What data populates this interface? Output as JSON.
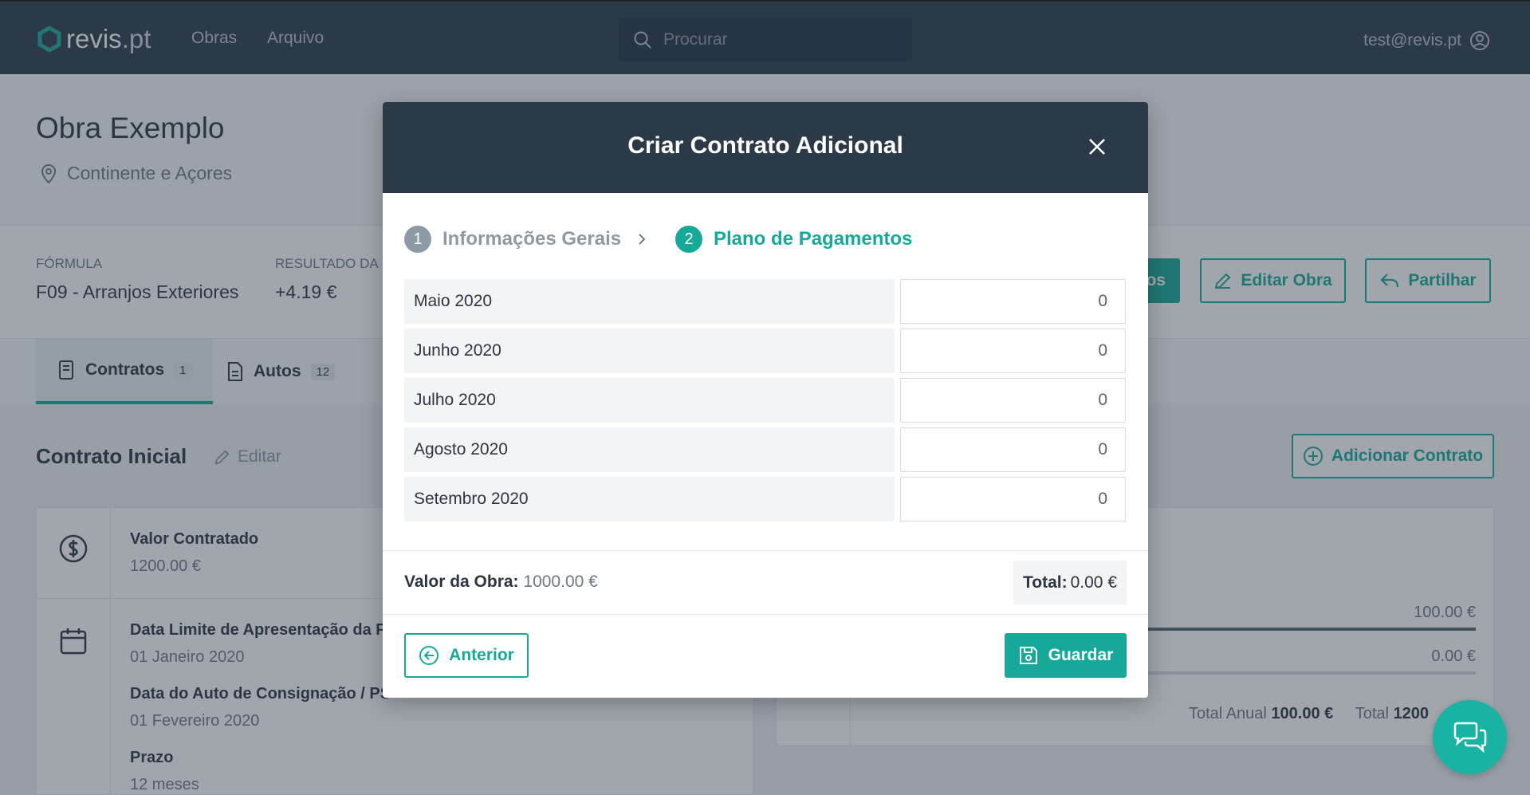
{
  "topbar": {
    "logo_text": "revis",
    "logo_suffix": ".pt",
    "nav": [
      "Obras",
      "Arquivo"
    ],
    "search_placeholder": "Procurar",
    "user_email": "test@revis.pt"
  },
  "obra": {
    "title": "Obra Exemplo",
    "location": "Continente e Açores"
  },
  "info": {
    "formula_label": "FÓRMULA",
    "formula_value": "F09 - Arranjos Exteriores",
    "resultado_label": "RESULTADO DA",
    "resultado_value": "+4.19 €",
    "partial_button_text": "ios",
    "edit_button": "Editar Obra",
    "share_button": "Partilhar"
  },
  "tabs": [
    {
      "label": "Contratos",
      "count": "1"
    },
    {
      "label": "Autos",
      "count": "12"
    }
  ],
  "contrato": {
    "title": "Contrato Inicial",
    "edit": "Editar",
    "add_button": "Adicionar Contrato",
    "valor_label": "Valor Contratado",
    "valor_value": "1200.00 €",
    "data_limite_label": "Data Limite de Apresentação da P",
    "data_limite_value": "01 Janeiro 2020",
    "data_auto_label": "Data do Auto de Consignação / PS",
    "data_auto_value": "01 Fevereiro 2020",
    "prazo_label": "Prazo",
    "prazo_value": "12 meses",
    "right_value_1": "100.00 €",
    "right_value_2": "0.00 €",
    "total_anual_label": "Total Anual",
    "total_anual_value": "100.00 €",
    "total_label": "Total",
    "total_value": "1200"
  },
  "modal": {
    "title": "Criar Contrato Adicional",
    "steps": [
      {
        "num": "1",
        "label": "Informações Gerais"
      },
      {
        "num": "2",
        "label": "Plano de Pagamentos"
      }
    ],
    "rows": [
      {
        "label": "Maio 2020",
        "value": "0"
      },
      {
        "label": "Junho 2020",
        "value": "0"
      },
      {
        "label": "Julho 2020",
        "value": "0"
      },
      {
        "label": "Agosto 2020",
        "value": "0"
      },
      {
        "label": "Setembro 2020",
        "value": "0"
      }
    ],
    "valor_obra_label": "Valor da Obra:",
    "valor_obra_value": "1000.00 €",
    "total_label": "Total:",
    "total_value": "0.00 €",
    "prev_button": "Anterior",
    "save_button": "Guardar"
  },
  "colors": {
    "primary": "#16a99a",
    "header": "#2c3a48"
  }
}
